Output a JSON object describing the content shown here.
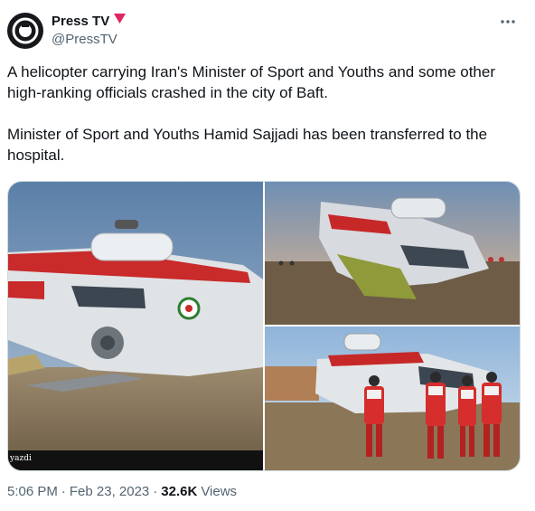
{
  "author": {
    "display_name": "Press TV",
    "handle": "@PressTV",
    "avatar_icon": "presstv-logo-icon",
    "badge_icon": "red-triangle-badge-icon",
    "badge_color": "#e0245e"
  },
  "tweet": {
    "paragraphs": [
      "A helicopter carrying Iran's Minister of Sport and Youths and some other high-ranking officials crashed in the city of Baft.",
      "Minister of Sport and Youths Hamid Sajjadi has been transferred to the hospital."
    ]
  },
  "media": {
    "watermark": "yazdi",
    "photos": [
      {
        "icon": "helicopter-crash-photo"
      },
      {
        "icon": "helicopter-wreck-photo"
      },
      {
        "icon": "rescue-workers-photo"
      }
    ]
  },
  "meta": {
    "time": "5:06 PM",
    "separator": "·",
    "date": "Feb 23, 2023",
    "views_count": "32.6K",
    "views_label": "Views"
  },
  "colors": {
    "text": "#0f1419",
    "secondary": "#536471",
    "border": "#cfd9de"
  }
}
